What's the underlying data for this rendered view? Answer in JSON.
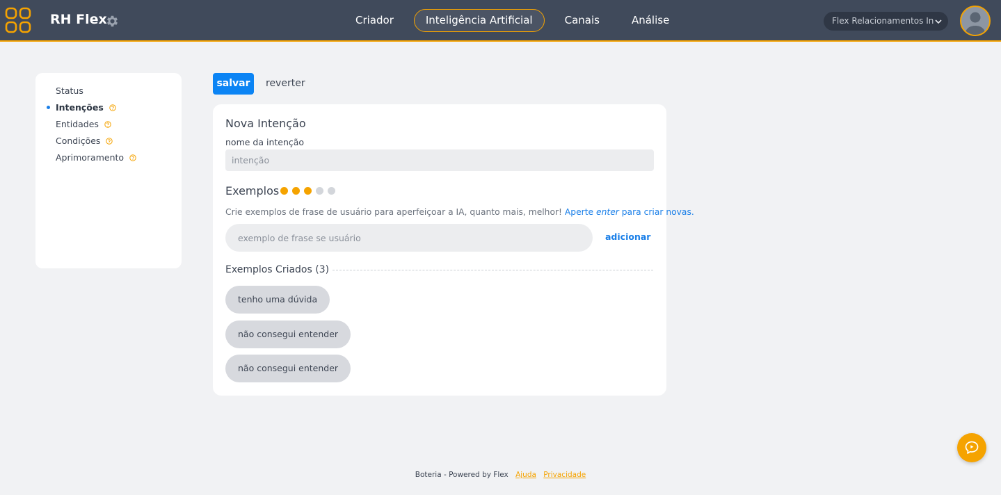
{
  "header": {
    "app_title": "RH Flex",
    "logo_icon": "app-logo-icon",
    "settings_icon": "gear-icon",
    "nav": [
      {
        "label": "Criador",
        "active": false
      },
      {
        "label": "Inteligência Artificial",
        "active": true
      },
      {
        "label": "Canais",
        "active": false
      },
      {
        "label": "Análise",
        "active": false
      }
    ],
    "org_selector": "Flex Relacionamentos In",
    "avatar_icon": "user-avatar"
  },
  "sidebar": {
    "items": [
      {
        "label": "Status",
        "active": false,
        "help": false
      },
      {
        "label": "Intenções",
        "active": true,
        "help": true
      },
      {
        "label": "Entidades",
        "active": false,
        "help": true
      },
      {
        "label": "Condições",
        "active": false,
        "help": true
      },
      {
        "label": "Aprimoramento",
        "active": false,
        "help": true
      }
    ]
  },
  "toolbar": {
    "save_label": "salvar",
    "revert_label": "reverter"
  },
  "form": {
    "title": "Nova Intenção",
    "name_label": "nome da intenção",
    "name_value": "",
    "name_placeholder": "intenção",
    "examples_title": "Exemplos",
    "progress": {
      "filled": 3,
      "total": 5
    },
    "hint_text": "Crie exemplos de frase de usuário para aperfeiçoar a IA, quanto mais, melhor! ",
    "hint_link_prefix": "Aperte ",
    "hint_link_em": "enter",
    "hint_link_suffix": " para criar novas.",
    "example_value": "",
    "example_placeholder": "exemplo de frase se usuário",
    "add_label": "adicionar",
    "created_title": "Exemplos Criados (3)",
    "created_examples": [
      "tenho uma dúvida",
      "não consegui entender",
      "não consegui entender"
    ]
  },
  "footer": {
    "text": "Boteria - Powered by Flex",
    "help_link": "Ajuda",
    "privacy_link": "Privacidade"
  },
  "colors": {
    "topbar": "#404a5b",
    "accent": "#f5a300",
    "primary": "#0b84f4",
    "link": "#1a7fe8",
    "dot_empty": "#d3d6db"
  },
  "chat_button_icon": "chat-bubble-icon"
}
